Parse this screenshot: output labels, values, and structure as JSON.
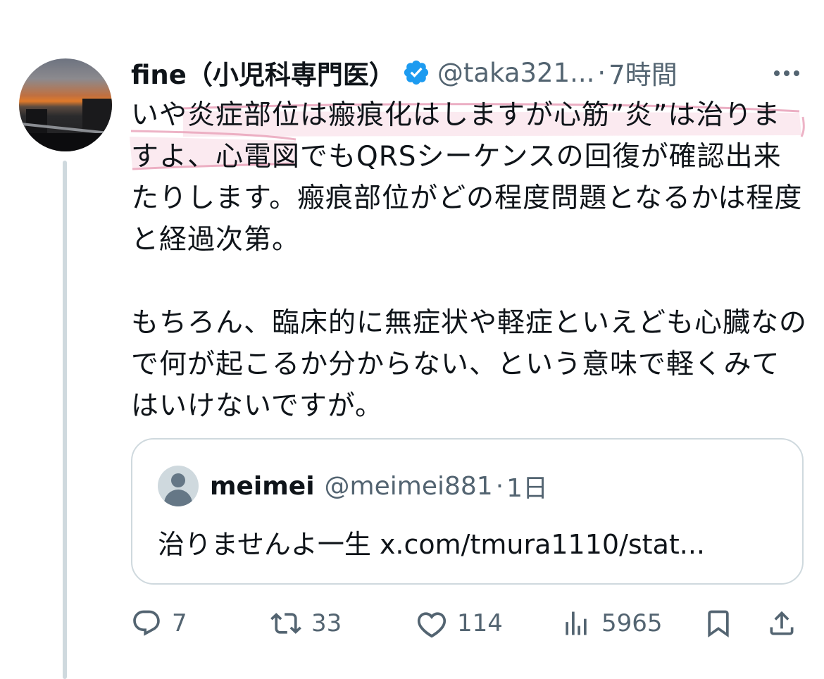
{
  "post": {
    "display_name": "fine（小児科専門医）",
    "handle": "@taka321...",
    "separator": "·",
    "time": "7時間",
    "body_paragraphs": [
      "いや炎症部位は瘢痕化はしますが心筋”炎”は治りますよ、心電図でもQRSシーケンスの回復が確認出来たりします。瘢痕部位がどの程度問題となるかは程度と経過次第。",
      "もちろん、臨床的に無症状や軽症といえども心臓なので何が起こるか分からない、という意味で軽くみてはいけないですが。"
    ]
  },
  "quote": {
    "display_name": "meimei",
    "handle": "@meimei881",
    "separator": "·",
    "time": "1日",
    "text": "治りませんよ一生 x.com/tmura1110/stat..."
  },
  "actions": {
    "replies": "7",
    "reposts": "33",
    "likes": "114",
    "views": "5965"
  },
  "icons": [
    "verified-badge-icon",
    "more-icon",
    "reply-icon",
    "repost-icon",
    "like-icon",
    "views-icon",
    "bookmark-icon",
    "share-icon"
  ],
  "colors": {
    "verified": "#1d9bf0",
    "secondary_text": "#536471",
    "highlight": "#e8a0b8"
  }
}
